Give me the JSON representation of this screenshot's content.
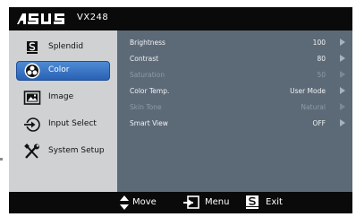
{
  "header": {
    "brand": "ASUS",
    "model": "VX248"
  },
  "sidebar": {
    "items": [
      {
        "label": "Splendid",
        "icon": "splendid-s-icon"
      },
      {
        "label": "Color",
        "icon": "color-palette-icon",
        "active": true
      },
      {
        "label": "Image",
        "icon": "image-icon"
      },
      {
        "label": "Input Select",
        "icon": "input-select-icon"
      },
      {
        "label": "System Setup",
        "icon": "wrench-screwdriver-icon"
      }
    ]
  },
  "settings": {
    "rows": [
      {
        "name": "Brightness",
        "value": "100"
      },
      {
        "name": "Contrast",
        "value": "80"
      },
      {
        "name": "Saturation",
        "value": "50",
        "disabled": true
      },
      {
        "name": "Color Temp.",
        "value": "User Mode"
      },
      {
        "name": "Skin Tone",
        "value": "Natural",
        "disabled": true
      },
      {
        "name": "Smart View",
        "value": "OFF"
      }
    ]
  },
  "footer": {
    "move_label": "Move",
    "menu_label": "Menu",
    "exit_label": "Exit"
  },
  "colors": {
    "selection": "#2f6fc3",
    "content_bg": "#5c6a78",
    "sidebar_bg": "#cfd1d3",
    "bar_bg": "#0a0a0a"
  }
}
